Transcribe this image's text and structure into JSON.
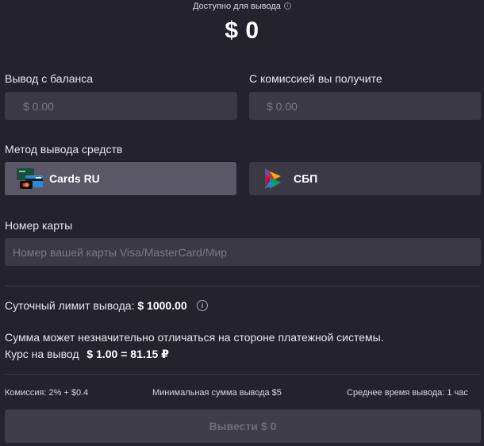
{
  "header": {
    "available_label": "Доступно для вывода",
    "available_value": "$ 0"
  },
  "amounts": {
    "withdraw_label": "Вывод с баланса",
    "withdraw_placeholder": "$ 0.00",
    "receive_label": "С комиссией вы получите",
    "receive_placeholder": "$ 0.00"
  },
  "method": {
    "label": "Метод вывода средств",
    "options": [
      {
        "label": "Cards RU",
        "icon": "bank-cards-icon",
        "selected": true
      },
      {
        "label": "СБП",
        "icon": "sbp-logo-icon",
        "selected": false
      }
    ]
  },
  "card": {
    "label": "Номер карты",
    "placeholder": "Номер вашей карты Visa/MasterCard/Мир"
  },
  "limits": {
    "daily_label": "Суточный лимит вывода:",
    "daily_value": "$ 1000.00",
    "note": "Сумма может незначительно отличаться на стороне платежной системы.",
    "rate_label": "Курс на вывод",
    "rate_value": "$ 1.00 = 81.15 ₽"
  },
  "footer": {
    "commission": "Комиссия: 2% + $0.4",
    "min_amount": "Минимальная сумма вывода $5",
    "avg_time": "Среднее время вывода:  1 час"
  },
  "submit": {
    "label": "Вывести",
    "amount": "$ 0"
  },
  "colors": {
    "background": "#24222d",
    "field": "#3b3945",
    "selected_method": "#5a5766",
    "disabled_button": "#3f3d48"
  }
}
